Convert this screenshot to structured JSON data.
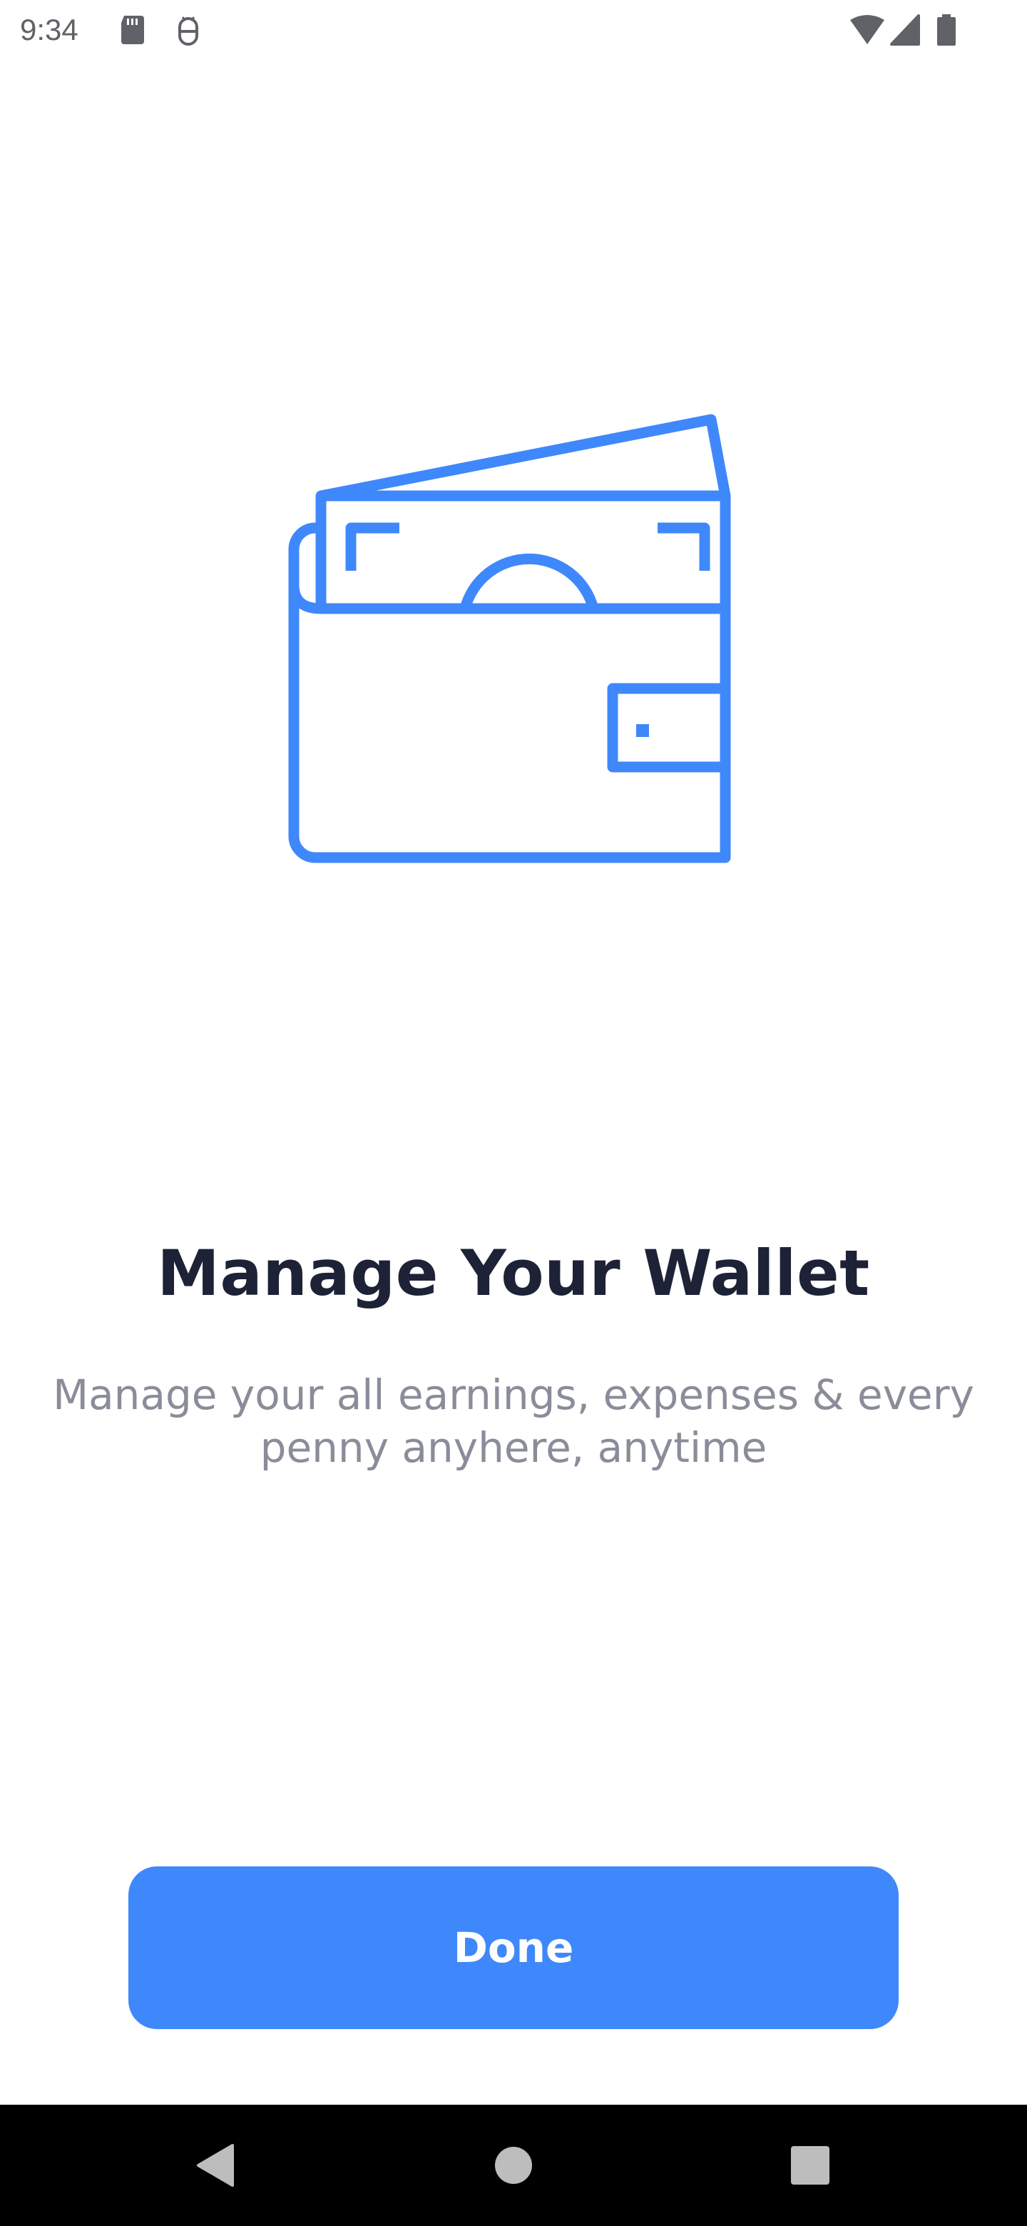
{
  "status_bar": {
    "time": "9:34",
    "icons": [
      "sd-card-icon",
      "android-debug-icon",
      "wifi-icon",
      "signal-icon",
      "battery-icon"
    ]
  },
  "illustration": {
    "icon": "wallet-icon",
    "color": "#3f88fb"
  },
  "onboarding": {
    "title": "Manage Your Wallet",
    "subtitle": "Manage your all earnings, expenses & every penny anyhere, anytime"
  },
  "actions": {
    "done_label": "Done",
    "button_color": "#3f88fb"
  },
  "navigation": {
    "icons": [
      "back-icon",
      "home-icon",
      "recents-icon"
    ]
  }
}
